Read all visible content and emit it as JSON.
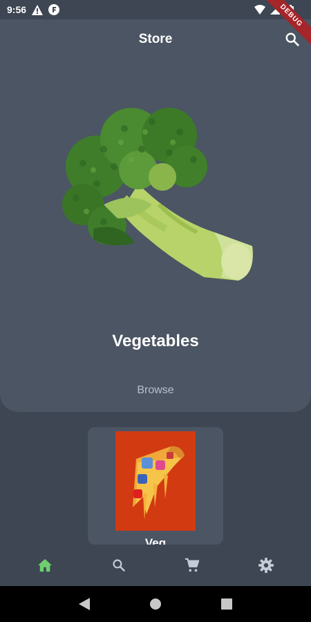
{
  "status_bar": {
    "time": "9:56",
    "icons": [
      "warning-icon",
      "f-app-icon",
      "wifi-icon",
      "signal-icon",
      "battery-icon"
    ]
  },
  "debug_ribbon": "DEBUG",
  "header": {
    "title": "Store",
    "search_icon": "search-icon"
  },
  "hero": {
    "image": "broccoli-image",
    "category": "Vegetables",
    "browse_label": "Browse"
  },
  "products": [
    {
      "label": "Veg",
      "image": "pizza-slice-image"
    }
  ],
  "bottom_nav": {
    "items": [
      {
        "icon": "home-icon",
        "active": true
      },
      {
        "icon": "search-icon",
        "active": false
      },
      {
        "icon": "cart-icon",
        "active": false
      },
      {
        "icon": "settings-icon",
        "active": false
      }
    ],
    "active_color": "#6fcf6f",
    "inactive_color": "#c4ccd8"
  },
  "colors": {
    "background": "#3d4652",
    "card": "#4b5563",
    "ribbon": "#a4252a",
    "product_thumb_bg": "#d23a12"
  }
}
